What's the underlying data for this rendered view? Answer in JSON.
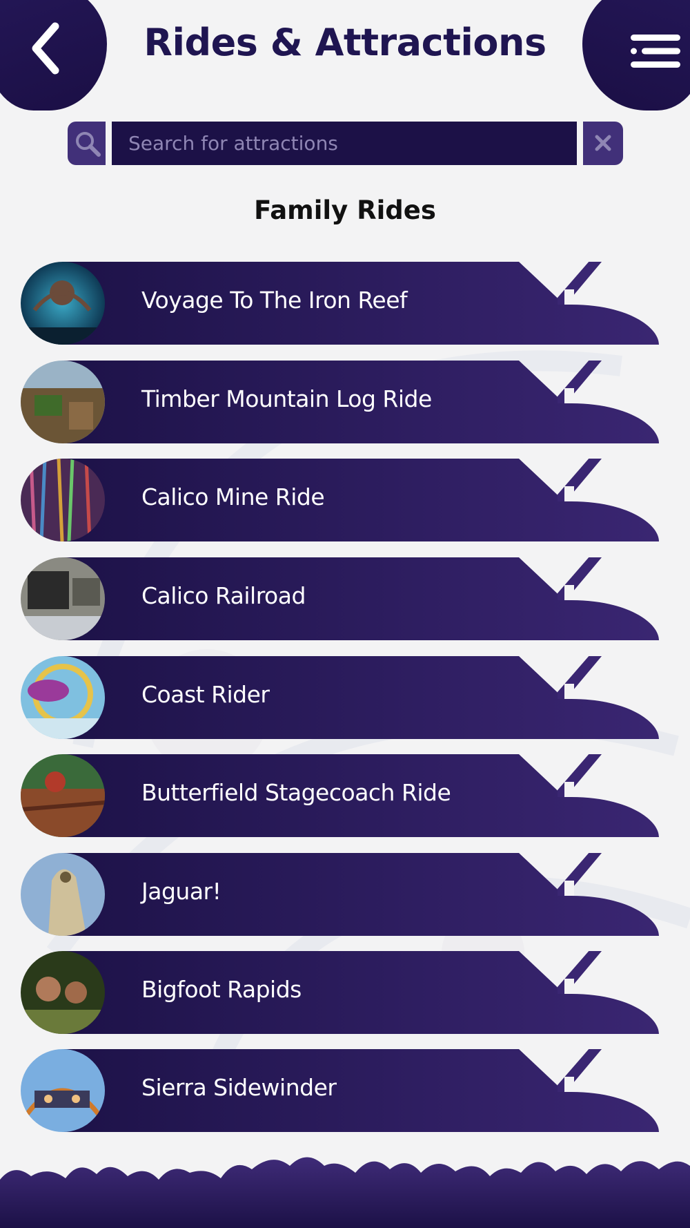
{
  "header": {
    "title": "Rides & Attractions",
    "back_icon": "chevron-left-icon",
    "menu_icon": "menu-icon"
  },
  "search": {
    "placeholder": "Search for attractions",
    "value": "",
    "search_icon": "search-icon",
    "clear_icon": "close-icon"
  },
  "section": {
    "title": "Family Rides"
  },
  "rides": [
    {
      "name": "Voyage To The Iron Reef"
    },
    {
      "name": "Timber Mountain Log Ride"
    },
    {
      "name": "Calico Mine Ride"
    },
    {
      "name": "Calico Railroad"
    },
    {
      "name": "Coast Rider"
    },
    {
      "name": "Butterfield Stagecoach Ride"
    },
    {
      "name": "Jaguar!"
    },
    {
      "name": "Bigfoot Rapids"
    },
    {
      "name": "Sierra Sidewinder"
    }
  ],
  "colors": {
    "primary_dark": "#1c1147",
    "primary": "#2a1a5f",
    "accent": "#413079",
    "background": "#f3f3f4",
    "title_text": "#1f1551"
  }
}
